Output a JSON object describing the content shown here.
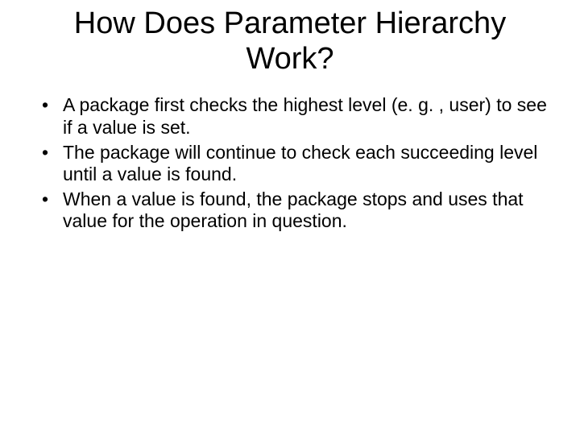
{
  "slide": {
    "title": "How Does Parameter Hierarchy Work?",
    "bullets": [
      "A package first checks the highest level (e. g. , user) to see if a value is set.",
      "The package will continue to check each succeeding level until a value is found.",
      "When a value is found, the package stops and uses that value for the operation in question."
    ]
  }
}
